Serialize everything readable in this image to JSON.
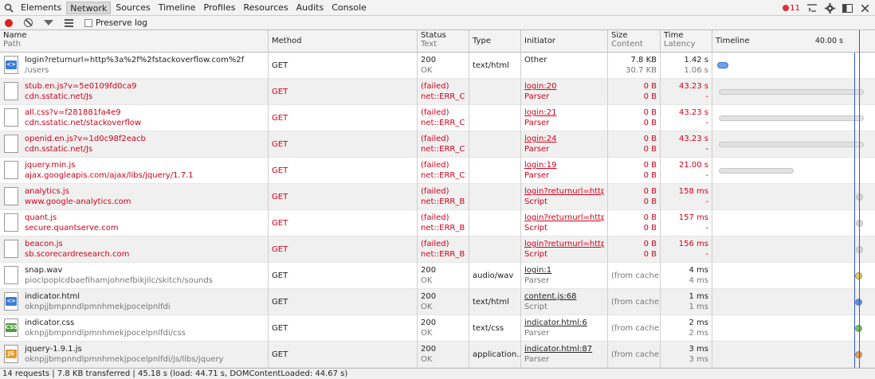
{
  "toolbar": {
    "tabs": [
      "Elements",
      "Network",
      "Sources",
      "Timeline",
      "Profiles",
      "Resources",
      "Audits",
      "Console"
    ],
    "active_tab": "Network",
    "error_count": "11"
  },
  "subbar": {
    "preserve_log_label": "Preserve log"
  },
  "header": {
    "name": "Name",
    "path": "Path",
    "method": "Method",
    "status": "Status",
    "text": "Text",
    "type": "Type",
    "initiator": "Initiator",
    "size": "Size",
    "content": "Content",
    "time": "Time",
    "latency": "Latency",
    "timeline": "Timeline",
    "timeline_marker": "40.00 s"
  },
  "rows": [
    {
      "name": "login?returnurl=http%3a%2f%2fstackoverflow.com%2f",
      "path": "/users",
      "method": "GET",
      "status": "200",
      "status_text": "OK",
      "type": "text/html",
      "initiator": "Other",
      "initiator_sub": "",
      "size": "7.8 KB",
      "content": "30.7 KB",
      "time": "1.42 s",
      "latency": "1.06 s",
      "icon": "html-file-icon",
      "failed": false
    },
    {
      "name": "stub.en.js?v=5e0109fd0ca9",
      "path": "cdn.sstatic.net/Js",
      "method": "GET",
      "status": "(failed)",
      "status_text": "net::ERR_CON",
      "type": "",
      "initiator": "login:20",
      "initiator_sub": "Parser",
      "size": "0 B",
      "content": "0 B",
      "time": "43.23 s",
      "latency": "-",
      "icon": "blank-file-icon",
      "failed": true
    },
    {
      "name": "all.css?v=f281881fa4e9",
      "path": "cdn.sstatic.net/stackoverflow",
      "method": "GET",
      "status": "(failed)",
      "status_text": "net::ERR_CON",
      "type": "",
      "initiator": "login:21",
      "initiator_sub": "Parser",
      "size": "0 B",
      "content": "0 B",
      "time": "43.23 s",
      "latency": "-",
      "icon": "blank-file-icon",
      "failed": true
    },
    {
      "name": "openid.en.js?v=1d0c98f2eacb",
      "path": "cdn.sstatic.net/Js",
      "method": "GET",
      "status": "(failed)",
      "status_text": "net::ERR_CON",
      "type": "",
      "initiator": "login:24",
      "initiator_sub": "Parser",
      "size": "0 B",
      "content": "0 B",
      "time": "43.23 s",
      "latency": "-",
      "icon": "blank-file-icon",
      "failed": true
    },
    {
      "name": "jquery.min.js",
      "path": "ajax.googleapis.com/ajax/libs/jquery/1.7.1",
      "method": "GET",
      "status": "(failed)",
      "status_text": "net::ERR_CON",
      "type": "",
      "initiator": "login:19",
      "initiator_sub": "Parser",
      "size": "0 B",
      "content": "0 B",
      "time": "21.00 s",
      "latency": "-",
      "icon": "blank-file-icon",
      "failed": true
    },
    {
      "name": "analytics.js",
      "path": "www.google-analytics.com",
      "method": "GET",
      "status": "(failed)",
      "status_text": "net::ERR_BLO",
      "type": "",
      "initiator": "login?returnurl=http...",
      "initiator_sub": "Script",
      "size": "0 B",
      "content": "0 B",
      "time": "158 ms",
      "latency": "-",
      "icon": "blank-file-icon",
      "failed": true
    },
    {
      "name": "quant.js",
      "path": "secure.quantserve.com",
      "method": "GET",
      "status": "(failed)",
      "status_text": "net::ERR_BLO",
      "type": "",
      "initiator": "login?returnurl=http...",
      "initiator_sub": "Script",
      "size": "0 B",
      "content": "0 B",
      "time": "157 ms",
      "latency": "-",
      "icon": "blank-file-icon",
      "failed": true
    },
    {
      "name": "beacon.js",
      "path": "sb.scorecardresearch.com",
      "method": "GET",
      "status": "(failed)",
      "status_text": "net::ERR_BLO",
      "type": "",
      "initiator": "login?returnurl=http...",
      "initiator_sub": "Script",
      "size": "0 B",
      "content": "0 B",
      "time": "156 ms",
      "latency": "-",
      "icon": "blank-file-icon",
      "failed": true
    },
    {
      "name": "snap.wav",
      "path": "pioclpoplcdbaefihamjohnefbikjilc/skitch/sounds",
      "method": "GET",
      "status": "200",
      "status_text": "OK",
      "type": "audio/wav",
      "initiator": "login:1",
      "initiator_sub": "Parser",
      "size": "(from cache)",
      "content": "",
      "time": "4 ms",
      "latency": "4 ms",
      "icon": "blank-file-icon",
      "failed": false
    },
    {
      "name": "indicator.html",
      "path": "oknpjjbmpnndlpmnhmekjpocelpnlfdi",
      "method": "GET",
      "status": "200",
      "status_text": "OK",
      "type": "text/html",
      "initiator": "content.js:68",
      "initiator_sub": "Script",
      "size": "(from cache)",
      "content": "",
      "time": "1 ms",
      "latency": "1 ms",
      "icon": "html-file-icon",
      "failed": false
    },
    {
      "name": "indicator.css",
      "path": "oknpjjbmpnndlpmnhmekjpocelpnlfdi/css",
      "method": "GET",
      "status": "200",
      "status_text": "OK",
      "type": "text/css",
      "initiator": "indicator.html:6",
      "initiator_sub": "Parser",
      "size": "(from cache)",
      "content": "",
      "time": "2 ms",
      "latency": "2 ms",
      "icon": "css-file-icon",
      "failed": false
    },
    {
      "name": "jquery-1.9.1.js",
      "path": "oknpjjbmpnndlpmnhmekjpocelpnlfdi/js/libs/jquery",
      "method": "GET",
      "status": "200",
      "status_text": "OK",
      "type": "application...",
      "initiator": "indicator.html:87",
      "initiator_sub": "Parser",
      "size": "(from cache)",
      "content": "",
      "time": "3 ms",
      "latency": "3 ms",
      "icon": "js-file-icon",
      "failed": false
    }
  ],
  "statusbar": "14 requests | 7.8 KB transferred | 45.18 s (load: 44.71 s, DOMContentLoaded: 44.67 s)",
  "colors": {
    "failed_red": "#d0021b",
    "dom_line": "#2e5cd6",
    "load_line": "#8b2cd6"
  }
}
